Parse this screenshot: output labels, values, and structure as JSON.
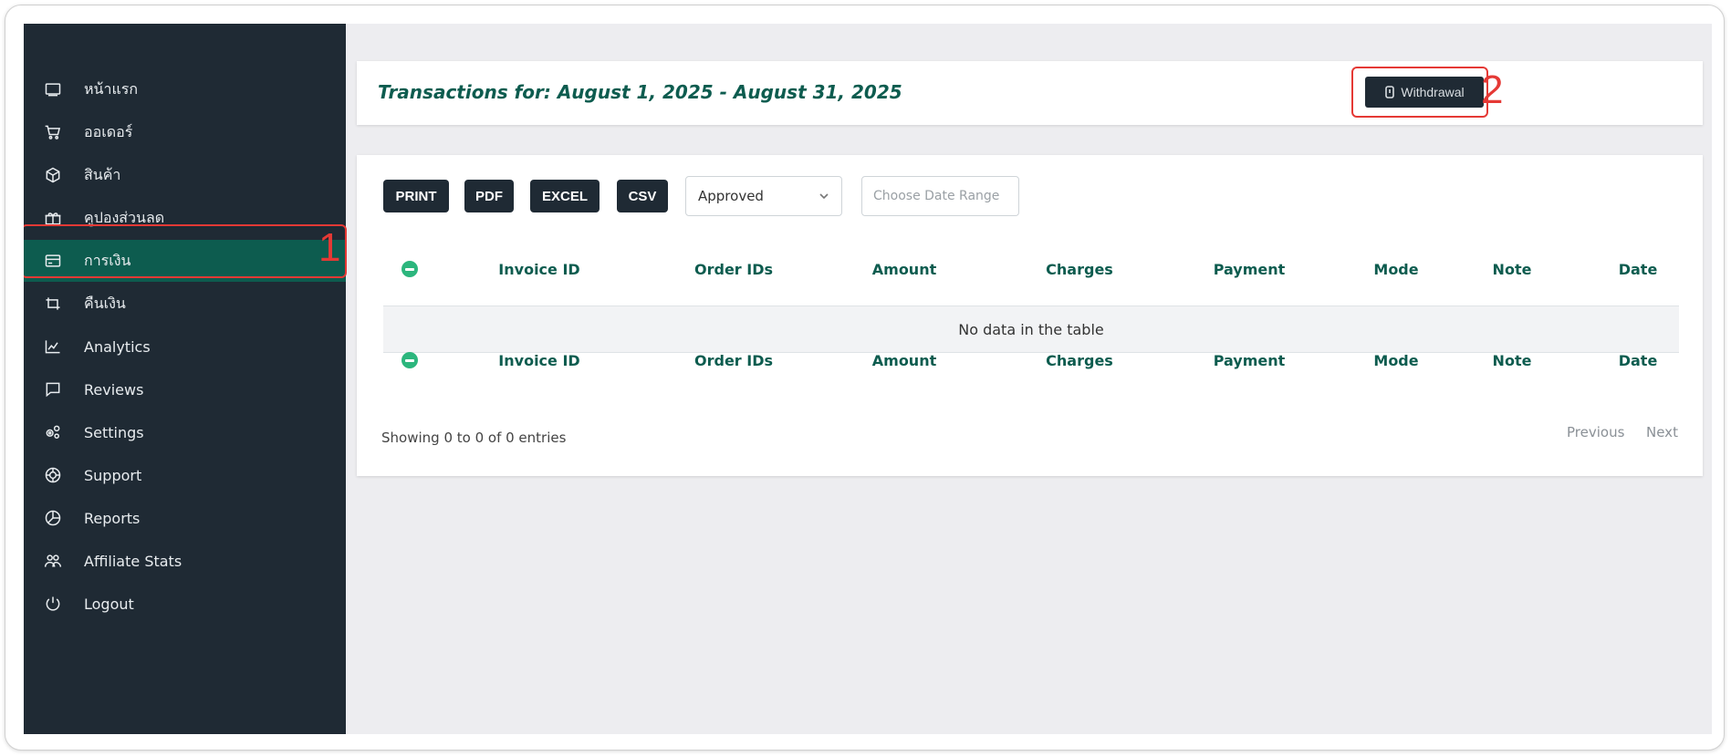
{
  "sidebar": {
    "items": [
      {
        "label": "หน้าแรก",
        "icon": "monitor-icon"
      },
      {
        "label": "ออเดอร์",
        "icon": "cart-icon"
      },
      {
        "label": "สินค้า",
        "icon": "box-icon"
      },
      {
        "label": "คูปองส่วนลด",
        "icon": "gift-icon"
      },
      {
        "label": "การเงิน",
        "icon": "credit-card-icon",
        "active": true
      },
      {
        "label": "คืนเงิน",
        "icon": "refund-icon"
      },
      {
        "label": "Analytics",
        "icon": "chart-icon"
      },
      {
        "label": "Reviews",
        "icon": "message-icon"
      },
      {
        "label": "Settings",
        "icon": "gears-icon"
      },
      {
        "label": "Support",
        "icon": "support-icon"
      },
      {
        "label": "Reports",
        "icon": "pie-icon"
      },
      {
        "label": "Affiliate Stats",
        "icon": "users-icon"
      },
      {
        "label": "Logout",
        "icon": "power-icon"
      }
    ]
  },
  "annotations": {
    "first": "1",
    "second": "2"
  },
  "header": {
    "title": "Transactions for: August 1, 2025 - August 31, 2025",
    "withdraw_label": "Withdrawal"
  },
  "toolbar": {
    "print_label": "PRINT",
    "pdf_label": "PDF",
    "excel_label": "EXCEL",
    "csv_label": "CSV",
    "status_value": "Approved",
    "date_placeholder": "Choose Date Range"
  },
  "table": {
    "columns": [
      "Invoice ID",
      "Order IDs",
      "Amount",
      "Charges",
      "Payment",
      "Mode",
      "Note",
      "Date"
    ],
    "empty_text": "No data in the table",
    "info_text": "Showing 0 to 0 of 0 entries",
    "previous_label": "Previous",
    "next_label": "Next"
  },
  "colors": {
    "sidebar_bg": "#1f2a34",
    "accent": "#0d5c4f",
    "annotation": "#e53935"
  }
}
